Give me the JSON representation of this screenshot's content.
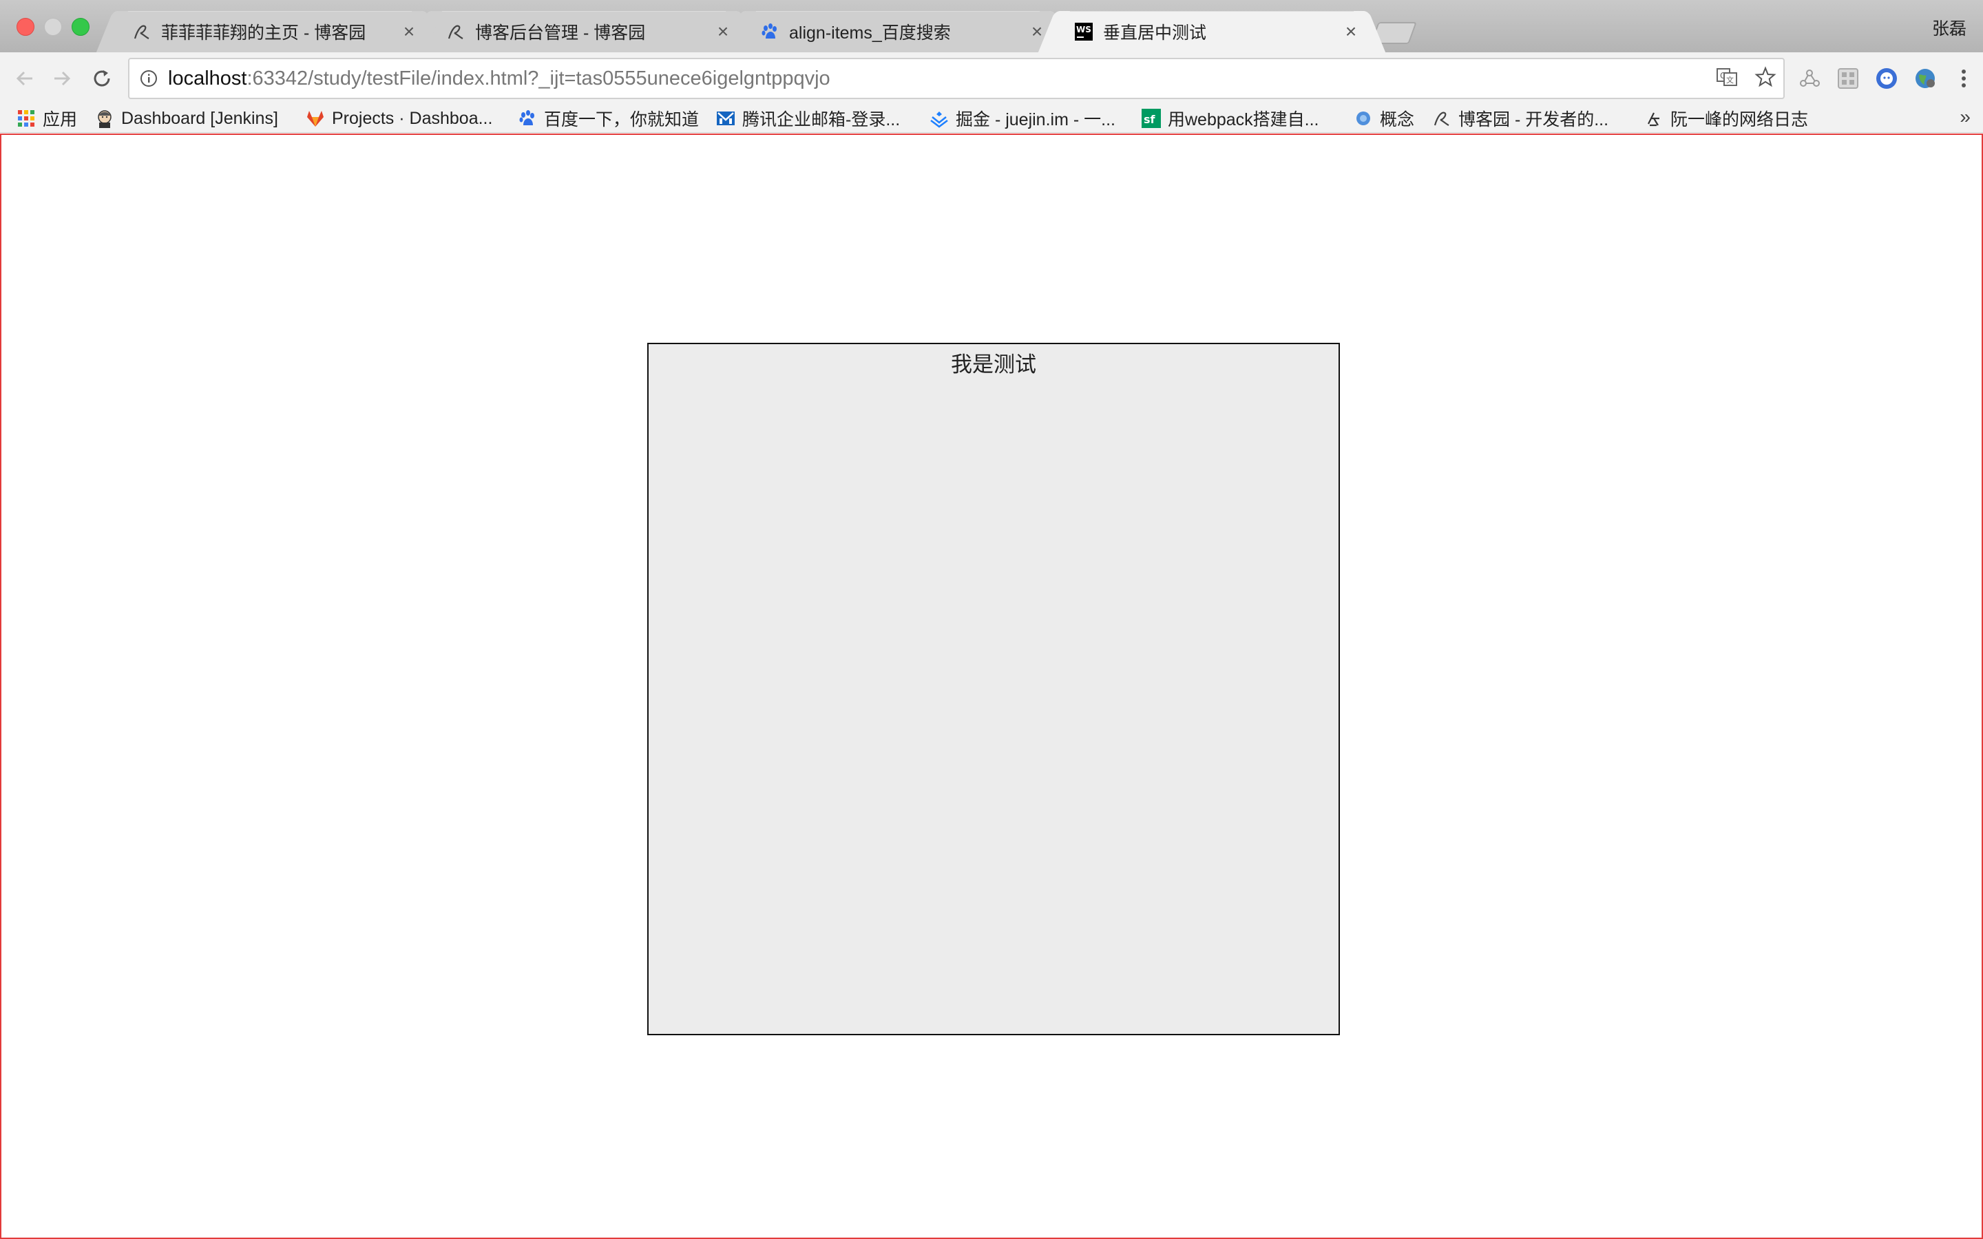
{
  "browser": {
    "user_name": "张磊",
    "tabs": [
      {
        "title": "菲菲菲菲翔的主页 - 博客园",
        "icon": "cnblogs-icon",
        "active": false
      },
      {
        "title": "博客后台管理 - 博客园",
        "icon": "cnblogs-icon",
        "active": false
      },
      {
        "title": "align-items_百度搜索",
        "icon": "baidu-paw-icon",
        "active": false
      },
      {
        "title": "垂直居中测试",
        "icon": "webstorm-icon",
        "active": true
      }
    ],
    "omnibox": {
      "host": "localhost",
      "rest": ":63342/study/testFile/index.html?_ijt=tas0555unece6igelgntppqvjo"
    },
    "bookmarks": [
      {
        "label": "应用",
        "icon": "apps-grid-icon"
      },
      {
        "label": "Dashboard [Jenkins]",
        "icon": "jenkins-icon"
      },
      {
        "label": "Projects · Dashboa...",
        "icon": "gitlab-icon"
      },
      {
        "label": "百度一下，你就知道",
        "icon": "baidu-paw-icon"
      },
      {
        "label": "腾讯企业邮箱-登录...",
        "icon": "tencent-mail-icon"
      },
      {
        "label": "掘金 - juejin.im - 一...",
        "icon": "juejin-icon"
      },
      {
        "label": "用webpack搭建自...",
        "icon": "segmentfault-icon"
      },
      {
        "label": "概念",
        "icon": "concept-icon"
      },
      {
        "label": "博客园 - 开发者的...",
        "icon": "cnblogs-icon"
      },
      {
        "label": "阮一峰的网络日志",
        "icon": "ruanyifeng-icon"
      }
    ],
    "bookmarks_overflow": "»"
  },
  "page": {
    "box_text": "我是测试"
  },
  "colors": {
    "page_border": "#e23b3b",
    "box_background": "#ececec",
    "box_border": "#111111"
  }
}
